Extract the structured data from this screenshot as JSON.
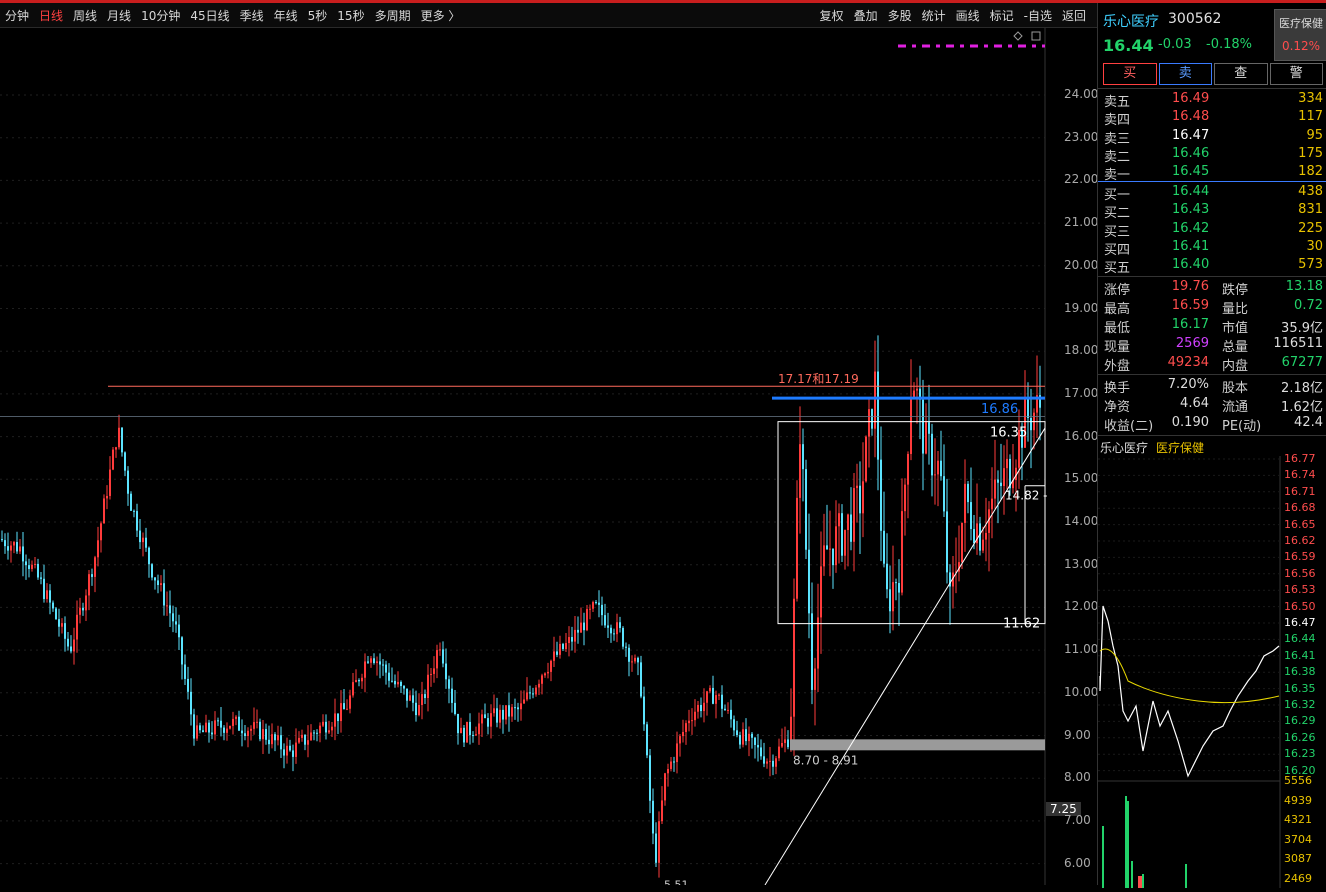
{
  "toolbar": {
    "left_items": [
      "分钟",
      "日线",
      "周线",
      "月线",
      "10分钟",
      "45日线",
      "季线",
      "年线",
      "5秒",
      "15秒",
      "多周期",
      "更多 〉"
    ],
    "active_index": 1,
    "right_items": [
      "复权",
      "叠加",
      "多股",
      "统计",
      "画线",
      "标记",
      "-自选",
      "返回"
    ]
  },
  "chart_data": {
    "type": "candlestick",
    "y_axis_ticks": [
      "24.00",
      "23.00",
      "22.00",
      "21.00",
      "20.00",
      "19.00",
      "18.00",
      "17.00",
      "16.00",
      "15.00",
      "14.00",
      "13.00",
      "12.00",
      "11.00",
      "10.00",
      "9.00",
      "8.00",
      "7.25",
      "7.00",
      "6.00"
    ],
    "annotations": {
      "resistance_label": "17.17和17.19",
      "blue_line_label": "16.86",
      "box_top_label": "16.35",
      "box_bottom_label": "11.62",
      "right_marker_label": "14.82 -",
      "support_band_label": "8.70 - 8.91",
      "low_label": "5.51",
      "axis_marker": "7.25"
    },
    "colors": {
      "up": "#ff3b3b",
      "down": "#5ce4ff",
      "resistance": "#ff6a5c",
      "blueline": "#1e7bff",
      "band": "#9a9a9a"
    }
  },
  "quote": {
    "name": "乐心医疗",
    "code": "300562",
    "price": "16.44",
    "change": "-0.03",
    "change_pct": "-0.18%",
    "sector_name": "医疗保健",
    "sector_pct": "0.12%"
  },
  "trade_buttons": [
    "买",
    "卖",
    "查",
    "警"
  ],
  "sell_orders": [
    {
      "label": "卖五",
      "price": "16.49",
      "vol": "334",
      "color": "#ff4d4d"
    },
    {
      "label": "卖四",
      "price": "16.48",
      "vol": "117",
      "color": "#ff4d4d"
    },
    {
      "label": "卖三",
      "price": "16.47",
      "vol": "95",
      "color": "#ffffff"
    },
    {
      "label": "卖二",
      "price": "16.46",
      "vol": "175",
      "color": "#22d36a"
    },
    {
      "label": "卖一",
      "price": "16.45",
      "vol": "182",
      "color": "#22d36a"
    }
  ],
  "buy_orders": [
    {
      "label": "买一",
      "price": "16.44",
      "vol": "438",
      "color": "#22d36a"
    },
    {
      "label": "买二",
      "price": "16.43",
      "vol": "831",
      "color": "#22d36a"
    },
    {
      "label": "买三",
      "price": "16.42",
      "vol": "225",
      "color": "#22d36a"
    },
    {
      "label": "买四",
      "price": "16.41",
      "vol": "30",
      "color": "#22d36a"
    },
    {
      "label": "买五",
      "price": "16.40",
      "vol": "573",
      "color": "#22d36a"
    }
  ],
  "info": [
    {
      "l1": "涨停",
      "v1": "19.76",
      "c1": "#ff4d4d",
      "l2": "跌停",
      "v2": "13.18",
      "c2": "#22d36a"
    },
    {
      "l1": "最高",
      "v1": "16.59",
      "c1": "#ff4d4d",
      "l2": "量比",
      "v2": "0.72",
      "c2": "#22d36a"
    },
    {
      "l1": "最低",
      "v1": "16.17",
      "c1": "#22d36a",
      "l2": "市值",
      "v2": "35.9亿",
      "c2": "#dddddd"
    },
    {
      "l1": "现量",
      "v1": "2569",
      "c1": "#d040ff",
      "l2": "总量",
      "v2": "116511",
      "c2": "#dddddd"
    },
    {
      "l1": "外盘",
      "v1": "49234",
      "c1": "#ff4d4d",
      "l2": "内盘",
      "v2": "67277",
      "c2": "#22d36a"
    }
  ],
  "info2": [
    {
      "l1": "换手",
      "v1": "7.20%",
      "c1": "#dddddd",
      "l2": "股本",
      "v2": "2.18亿",
      "c2": "#dddddd"
    },
    {
      "l1": "净资",
      "v1": "4.64",
      "c1": "#dddddd",
      "l2": "流通",
      "v2": "1.62亿",
      "c2": "#dddddd"
    },
    {
      "l1": "收益(二)",
      "v1": "0.190",
      "c1": "#dddddd",
      "l2": "PE(动)",
      "v2": "42.4",
      "c2": "#dddddd"
    }
  ],
  "mini": {
    "name": "乐心医疗",
    "sector": "医疗保健",
    "price_labels": [
      "16.77",
      "16.74",
      "16.71",
      "16.68",
      "16.65",
      "16.62",
      "16.59",
      "16.56",
      "16.53",
      "16.50",
      "16.47",
      "16.44",
      "16.41",
      "16.38",
      "16.35",
      "16.32",
      "16.29",
      "16.26",
      "16.23",
      "16.20"
    ],
    "volume_labels": [
      "5556",
      "4939",
      "4321",
      "3704",
      "3087",
      "2469"
    ]
  }
}
